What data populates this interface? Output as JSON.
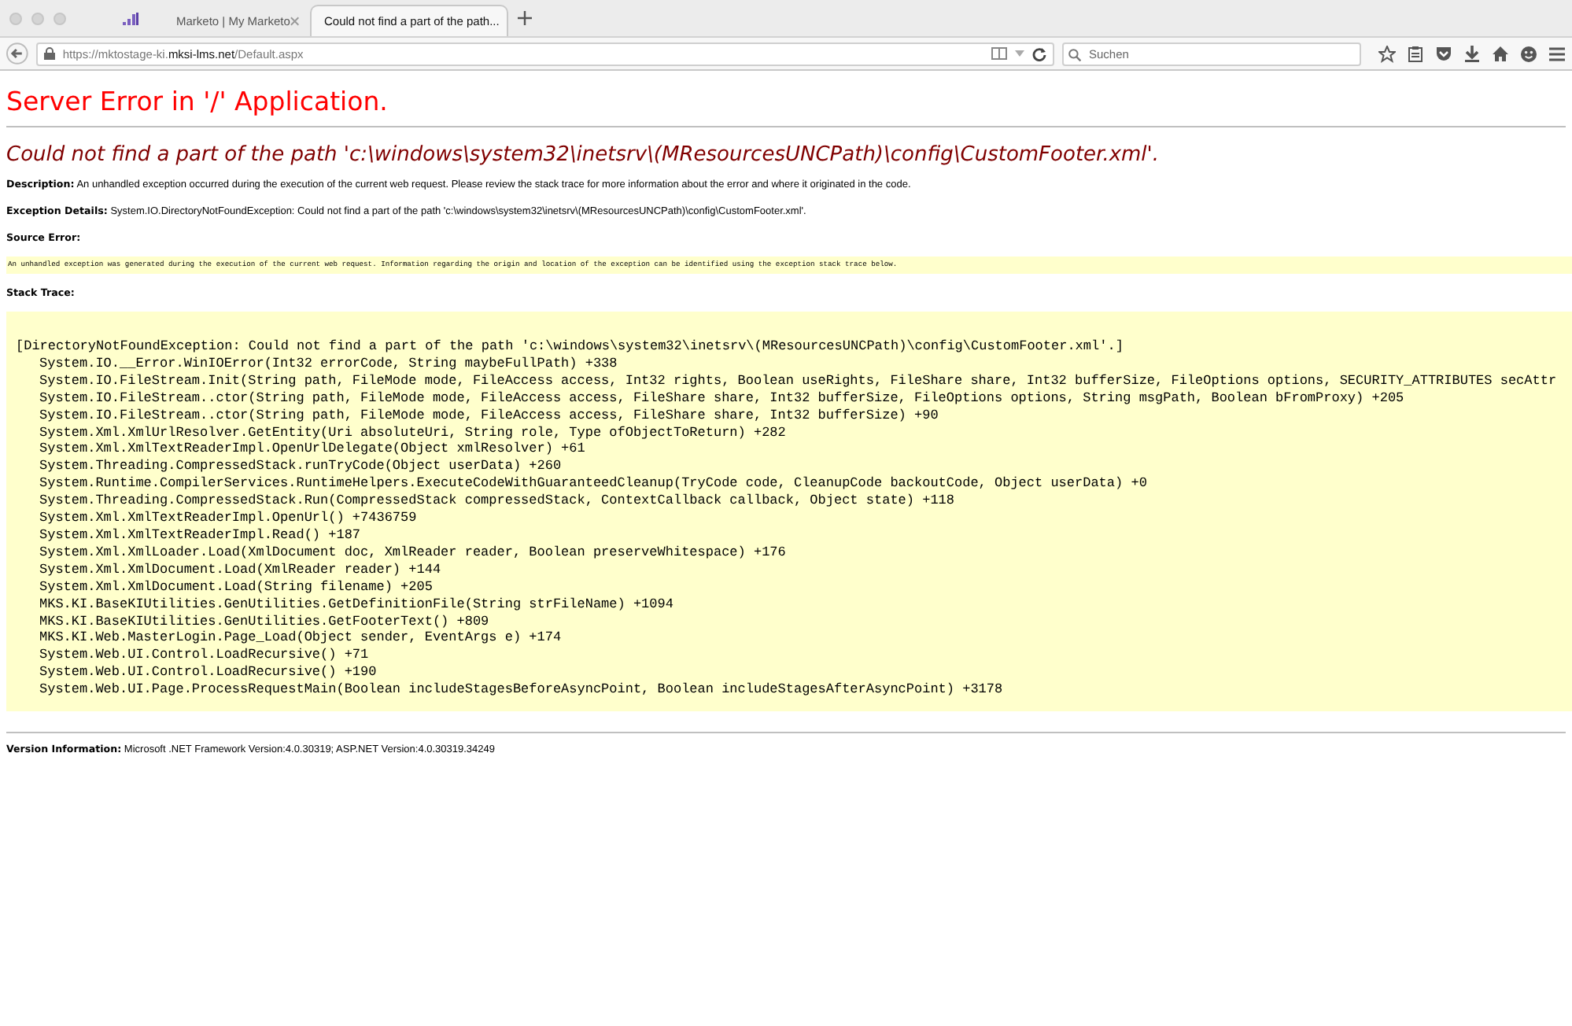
{
  "browser": {
    "tabs": [
      {
        "label": "Marketo | My Marketo",
        "selected": false
      },
      {
        "label": "Could not find a part of the path...",
        "selected": true
      }
    ],
    "url": "https://mktostage-ki.**mksi-lms.net**/Default.aspx",
    "search": {
      "placeholder": "Suchen"
    }
  },
  "page": {
    "title": "Server Error in '/' Application.",
    "error_heading": "Could not find a part of the path 'c:\\windows\\system32\\inetsrv\\(MResourcesUNCPath)\\config\\CustomFooter.xml'.",
    "description": {
      "label": "Description:",
      "text": "An unhandled exception occurred during the execution of the current web request. Please review the stack trace for more information about the error and where it originated in the code."
    },
    "exception_details": {
      "label": "Exception Details:",
      "text": "System.IO.DirectoryNotFoundException: Could not find a part of the path 'c:\\windows\\system32\\inetsrv\\(MResourcesUNCPath)\\config\\CustomFooter.xml'."
    },
    "source_error": {
      "label": "Source Error:",
      "text": "An unhandled exception was generated during the execution of the current web request. Information regarding the origin and location of the exception can be identified using the exception stack trace below."
    },
    "stack_trace": {
      "label": "Stack Trace:",
      "exception": "[DirectoryNotFoundException: Could not find a part of the path 'c:\\windows\\system32\\inetsrv\\(MResourcesUNCPath)\\config\\CustomFooter.xml'.]",
      "frames": [
        "System.IO.__Error.WinIOError(Int32 errorCode, String maybeFullPath) +338",
        "System.IO.FileStream.Init(String path, FileMode mode, FileAccess access, Int32 rights, Boolean useRights, FileShare share, Int32 bufferSize, FileOptions options, SECURITY_ATTRIBUTES secAttr",
        "System.IO.FileStream..ctor(String path, FileMode mode, FileAccess access, FileShare share, Int32 bufferSize, FileOptions options, String msgPath, Boolean bFromProxy) +205",
        "System.IO.FileStream..ctor(String path, FileMode mode, FileAccess access, FileShare share, Int32 bufferSize) +90",
        "System.Xml.XmlUrlResolver.GetEntity(Uri absoluteUri, String role, Type ofObjectToReturn) +282",
        "System.Xml.XmlTextReaderImpl.OpenUrlDelegate(Object xmlResolver) +61",
        "System.Threading.CompressedStack.runTryCode(Object userData) +260",
        "System.Runtime.CompilerServices.RuntimeHelpers.ExecuteCodeWithGuaranteedCleanup(TryCode code, CleanupCode backoutCode, Object userData) +0",
        "System.Threading.CompressedStack.Run(CompressedStack compressedStack, ContextCallback callback, Object state) +118",
        "System.Xml.XmlTextReaderImpl.OpenUrl() +7436759",
        "System.Xml.XmlTextReaderImpl.Read() +187",
        "System.Xml.XmlLoader.Load(XmlDocument doc, XmlReader reader, Boolean preserveWhitespace) +176",
        "System.Xml.XmlDocument.Load(XmlReader reader) +144",
        "System.Xml.XmlDocument.Load(String filename) +205",
        "MKS.KI.BaseKIUtilities.GenUtilities.GetDefinitionFile(String strFileName) +1094",
        "MKS.KI.BaseKIUtilities.GenUtilities.GetFooterText() +809",
        "MKS.KI.Web.MasterLogin.Page_Load(Object sender, EventArgs e) +174",
        "System.Web.UI.Control.LoadRecursive() +71",
        "System.Web.UI.Control.LoadRecursive() +190",
        "System.Web.UI.Page.ProcessRequestMain(Boolean includeStagesBeforeAsyncPoint, Boolean includeStagesAfterAsyncPoint) +3178"
      ]
    },
    "version_info": {
      "label": "Version Information:",
      "text": "Microsoft .NET Framework Version:4.0.30319; ASP.NET Version:4.0.30319.34249"
    }
  }
}
